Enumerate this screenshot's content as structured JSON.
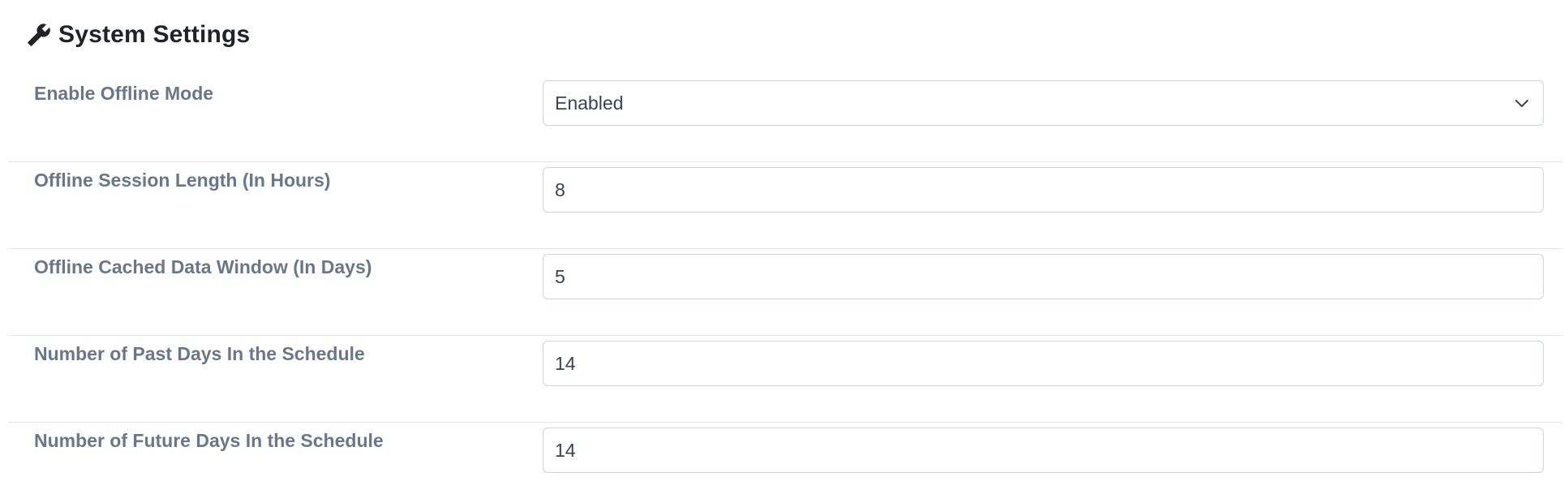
{
  "header": {
    "icon": "wrench-icon",
    "title": "System Settings"
  },
  "settings": [
    {
      "label": "Enable Offline Mode",
      "type": "select",
      "value": "Enabled",
      "icon": "chevron-down-icon"
    },
    {
      "label": "Offline Session Length (In Hours)",
      "type": "input",
      "value": "8"
    },
    {
      "label": "Offline Cached Data Window (In Days)",
      "type": "input",
      "value": "5"
    },
    {
      "label": "Number of Past Days In the Schedule",
      "type": "input",
      "value": "14"
    },
    {
      "label": "Number of Future Days In the Schedule",
      "type": "input",
      "value": "14"
    }
  ],
  "colors": {
    "title": "#1f2329",
    "label": "#6b7789",
    "border": "#cfd4da",
    "divider": "#e3e6ea"
  }
}
